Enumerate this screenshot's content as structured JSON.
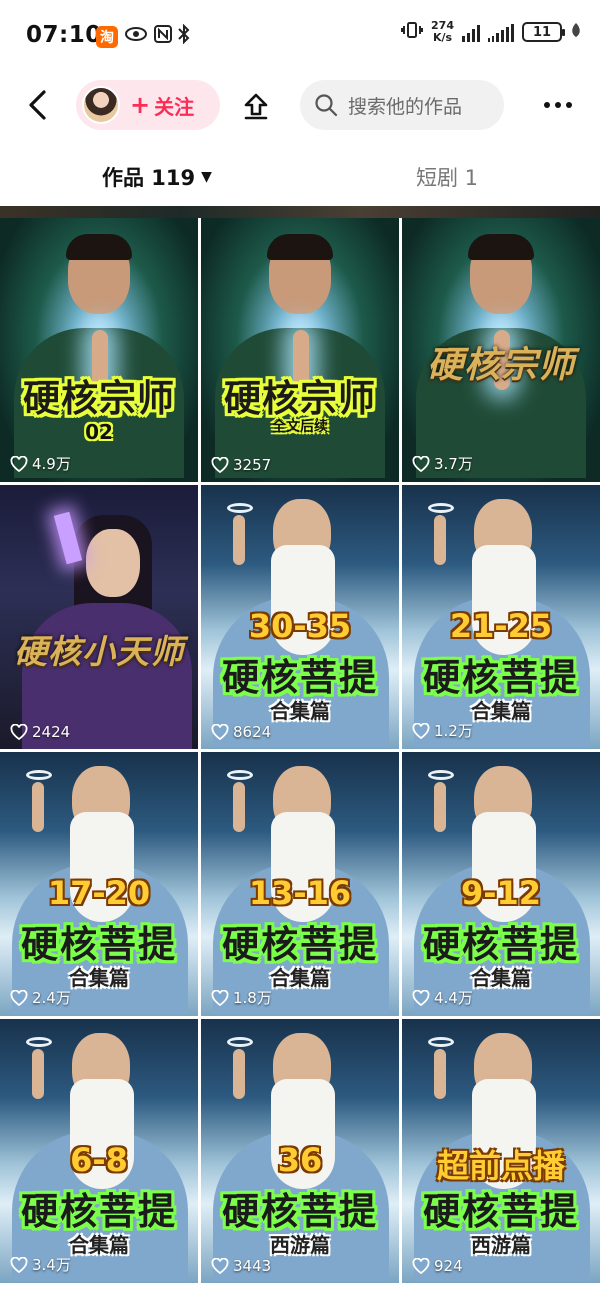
{
  "status_bar": {
    "time": "07:10",
    "taobao_glyph": "淘",
    "net_speed_value": "274",
    "net_speed_unit": "K/s",
    "battery": "11"
  },
  "nav": {
    "follow_label": "关注",
    "search_placeholder": "搜索他的作品"
  },
  "tabs": {
    "works_label": "作品 119",
    "shorts_label": "短剧 1"
  },
  "tiles": [
    {
      "theme": "man",
      "title": "硬核宗师",
      "title_style": "yellow",
      "sub": "02",
      "likes": "4.9万"
    },
    {
      "theme": "man",
      "title": "硬核宗师",
      "title_style": "yellow",
      "sub": "全文后续",
      "likes": "3257"
    },
    {
      "theme": "man",
      "title": "硬核宗师",
      "title_style": "gold",
      "sub": "",
      "likes": "3.7万"
    },
    {
      "theme": "priest",
      "title": "硬核小天师",
      "title_style": "gold",
      "sub": "",
      "likes": "2424"
    },
    {
      "theme": "sage",
      "num": "30-35",
      "title": "硬核菩提",
      "title_style": "green",
      "sub": "合集篇",
      "likes": "8624"
    },
    {
      "theme": "sage",
      "num": "21-25",
      "title": "硬核菩提",
      "title_style": "green",
      "sub": "合集篇",
      "likes": "1.2万"
    },
    {
      "theme": "sage",
      "num": "17-20",
      "title": "硬核菩提",
      "title_style": "green",
      "sub": "合集篇",
      "likes": "2.4万"
    },
    {
      "theme": "sage",
      "num": "13-16",
      "title": "硬核菩提",
      "title_style": "green",
      "sub": "合集篇",
      "likes": "1.8万"
    },
    {
      "theme": "sage",
      "num": "9-12",
      "title": "硬核菩提",
      "title_style": "green",
      "sub": "合集篇",
      "likes": "4.4万"
    },
    {
      "theme": "sage",
      "num": "6-8",
      "title": "硬核菩提",
      "title_style": "green",
      "sub": "合集篇",
      "likes": "3.4万"
    },
    {
      "theme": "sage",
      "num": "36",
      "title": "硬核菩提",
      "title_style": "green",
      "sub": "西游篇",
      "likes": "3443"
    },
    {
      "theme": "sage",
      "num": "超前点播",
      "title": "硬核菩提",
      "title_style": "green",
      "sub": "西游篇",
      "likes": "924"
    }
  ]
}
